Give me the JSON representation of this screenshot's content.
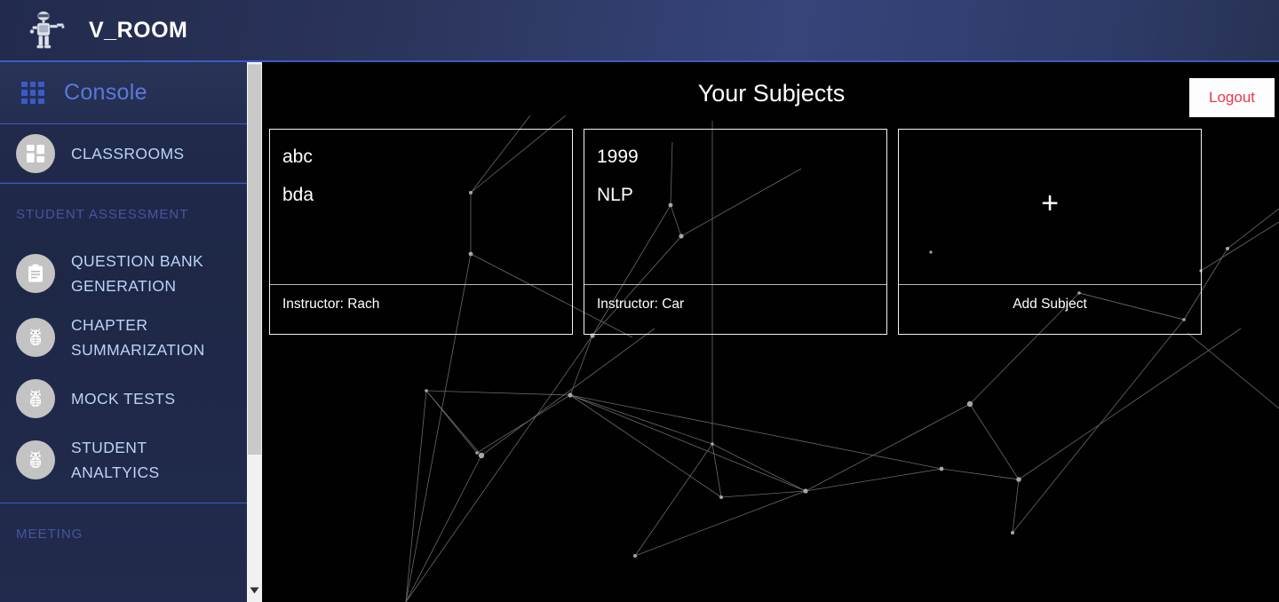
{
  "header": {
    "brand_title": "V_ROOM",
    "logo_icon": "robot-icon"
  },
  "sidebar": {
    "console": {
      "label": "Console",
      "icon": "grid-apps-icon"
    },
    "primary_items": [
      {
        "label": "CLASSROOMS",
        "icon": "dashboard-quadrant-icon"
      }
    ],
    "sections": [
      {
        "title": "STUDENT ASSESSMENT",
        "items": [
          {
            "label": "QUESTION BANK GENERATION",
            "icon": "clipboard-icon"
          },
          {
            "label": "CHAPTER SUMMARIZATION",
            "icon": "bug-robot-icon"
          },
          {
            "label": "MOCK TESTS",
            "icon": "bug-robot-icon"
          },
          {
            "label": "STUDENT ANALTYICS",
            "icon": "bug-robot-icon"
          }
        ]
      },
      {
        "title": "MEETING",
        "items": []
      }
    ],
    "scrollbar": {
      "down_arrow_icon": "chevron-down-icon"
    }
  },
  "main": {
    "page_title": "Your Subjects",
    "logout_label": "Logout",
    "subject_cards": [
      {
        "code": "abc",
        "name": "bda",
        "instructor": "Instructor: Rach"
      },
      {
        "code": "1999",
        "name": "NLP",
        "instructor": "Instructor: Car"
      }
    ],
    "add_card": {
      "plus": "+",
      "label": "Add Subject",
      "icon": "plus-icon"
    }
  },
  "colors": {
    "header_blue": "#2a3358",
    "accent_blue": "#3a5bc7",
    "console_text": "#5d77d8",
    "nav_text": "#bcd3f7",
    "section_text": "#45569e",
    "logout_red": "#e8384f",
    "canvas_black": "#010101",
    "card_border": "#f2f2f2"
  }
}
